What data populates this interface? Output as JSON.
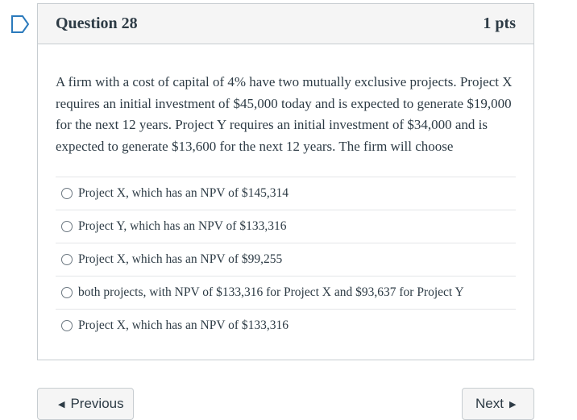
{
  "question": {
    "title": "Question 28",
    "points": "1 pts",
    "text": "A firm with a cost of capital of 4% have two mutually exclusive projects. Project X requires an initial investment of $45,000 today and is expected to generate $19,000 for the next 12 years. Project Y requires an initial investment of $34,000 and is expected to generate $13,600 for the next 12 years. The firm will choose",
    "answers": [
      {
        "label": "Project X, which has an NPV of $145,314"
      },
      {
        "label": "Project Y, which has an NPV of $133,316"
      },
      {
        "label": "Project X, which has an NPV of $99,255"
      },
      {
        "label": "both projects, with NPV of $133,316 for Project X and $93,637 for Project Y"
      },
      {
        "label": "Project X, which has an NPV of $133,316"
      }
    ]
  },
  "nav": {
    "previous_label": "Previous",
    "next_label": "Next",
    "previous_icon": "triangle-left",
    "next_icon": "triangle-right"
  },
  "icons": {
    "bookmark": "bookmark-flag-outline"
  },
  "colors": {
    "bookmark_stroke": "#2b7abc",
    "text": "#2d3b45",
    "header_bg": "#f5f5f5",
    "border": "#c7cdd1"
  }
}
